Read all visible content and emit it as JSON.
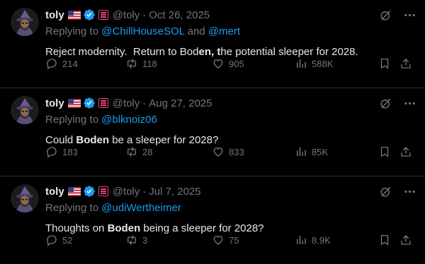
{
  "colors": {
    "background": "#000000",
    "text": "#e7e9ea",
    "muted": "#71767b",
    "link": "#1d9bf0",
    "divider": "#2f3336",
    "verified": "#1d9bf0",
    "sol_badge": "#e0457b"
  },
  "tweets": [
    {
      "name": "toly",
      "handle": "@toly",
      "separator": "·",
      "date": "Oct 26, 2025",
      "reply_prefix": "Replying to ",
      "reply_mentions": [
        "@ChillHouseSOL",
        "@mert"
      ],
      "reply_joiner": " and ",
      "text_parts": [
        {
          "t": "Reject modernity.  Return to Bod",
          "b": false
        },
        {
          "t": "en, t",
          "b": true
        },
        {
          "t": "he potential sleeper for 2028.",
          "b": false
        }
      ],
      "stats": {
        "replies": "214",
        "reposts": "118",
        "likes": "905",
        "views": "588K"
      }
    },
    {
      "name": "toly",
      "handle": "@toly",
      "separator": "·",
      "date": "Aug 27, 2025",
      "reply_prefix": "Replying to ",
      "reply_mentions": [
        "@blknoiz06"
      ],
      "reply_joiner": "",
      "text_parts": [
        {
          "t": "Could ",
          "b": false
        },
        {
          "t": "Boden",
          "b": true
        },
        {
          "t": " be a sleeper for 2028?",
          "b": false
        }
      ],
      "stats": {
        "replies": "183",
        "reposts": "28",
        "likes": "833",
        "views": "85K"
      }
    },
    {
      "name": "toly",
      "handle": "@toly",
      "separator": "·",
      "date": "Jul 7, 2025",
      "reply_prefix": "Replying to ",
      "reply_mentions": [
        "@udiWertheimer"
      ],
      "reply_joiner": "",
      "text_parts": [
        {
          "t": "Thoughts on ",
          "b": false
        },
        {
          "t": "Boden",
          "b": true
        },
        {
          "t": " being a sleeper for 2028?",
          "b": false
        }
      ],
      "stats": {
        "replies": "52",
        "reposts": "3",
        "likes": "75",
        "views": "8.9K"
      }
    }
  ],
  "icons": {
    "flag": "us-flag-icon",
    "verified": "verified-badge-icon",
    "sol": "solana-badge-icon",
    "grok": "grok-icon",
    "more": "more-icon",
    "reply": "reply-icon",
    "repost": "repost-icon",
    "like": "like-icon",
    "views": "views-icon",
    "bookmark": "bookmark-icon",
    "share": "share-icon"
  }
}
